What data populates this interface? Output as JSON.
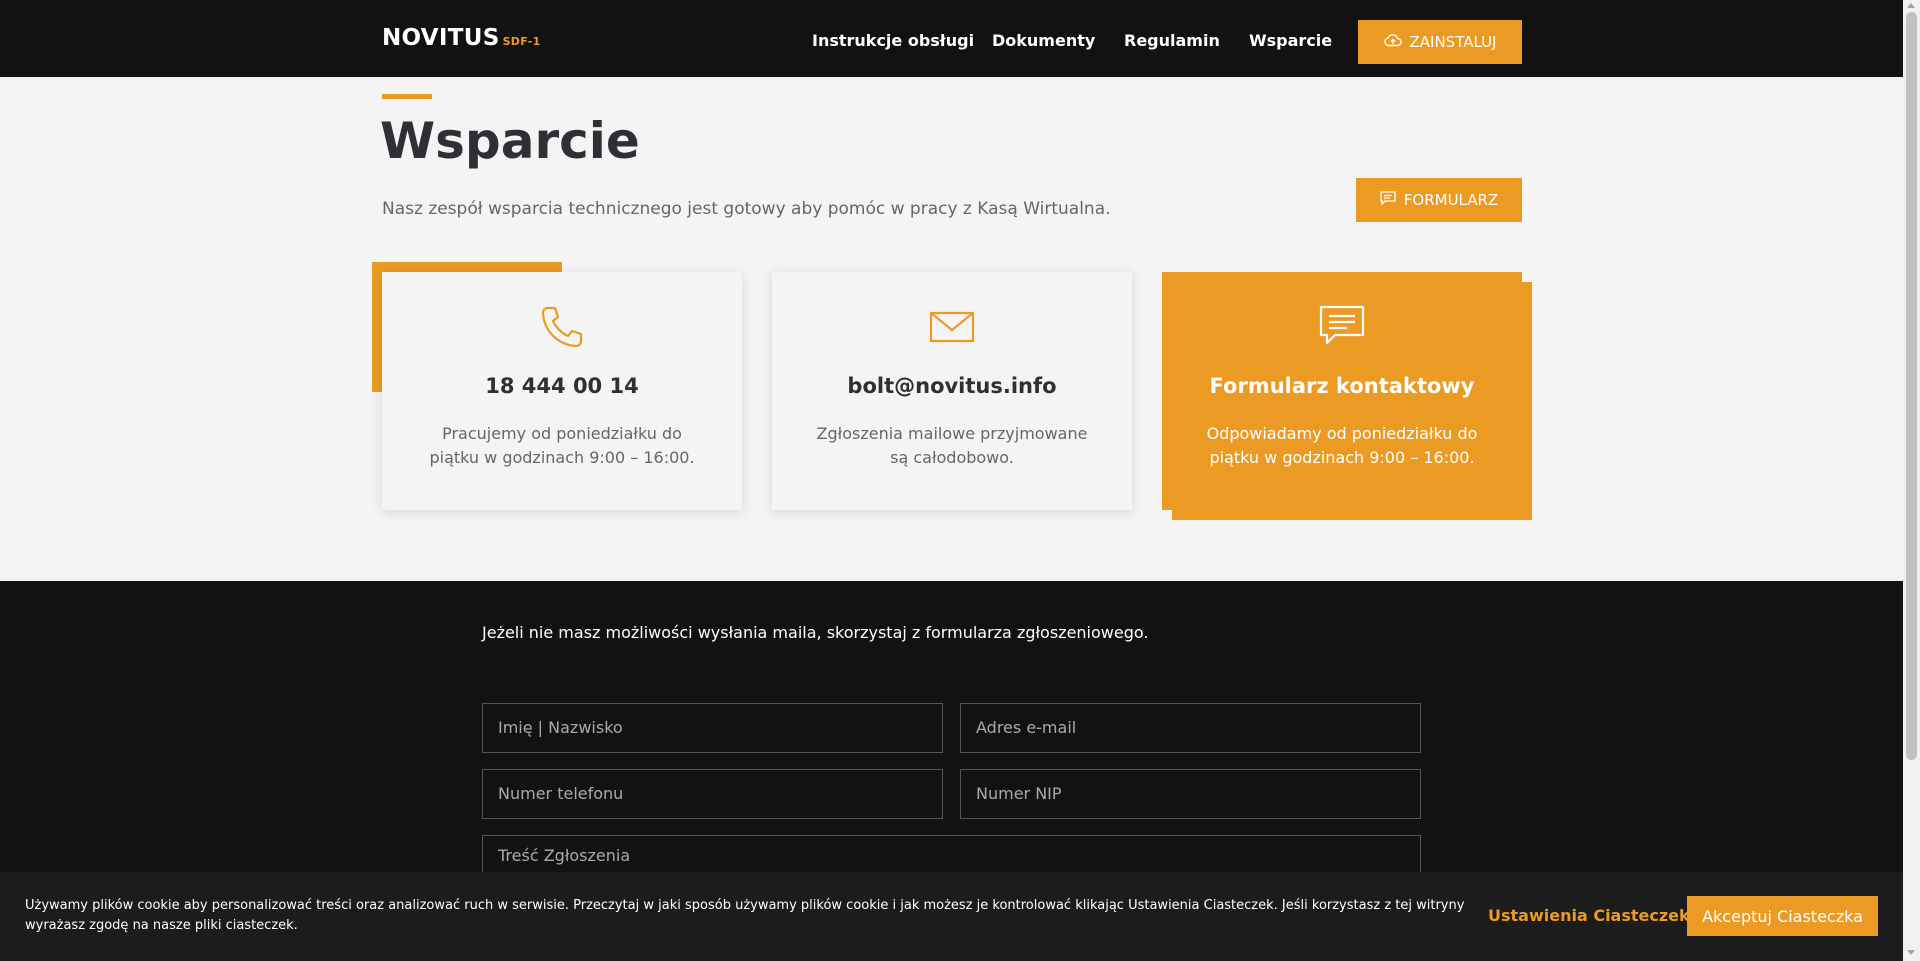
{
  "header": {
    "logo": "NOVITUS",
    "logo_sub": "SDF-1",
    "nav": [
      "Instrukcje obsługi",
      "Dokumenty",
      "Regulamin",
      "Wsparcie"
    ],
    "install_label": "ZAINSTALUJ"
  },
  "hero": {
    "title": "Wsparcie",
    "subtitle": "Nasz zespół wsparcia technicznego jest gotowy aby pomóc w pracy z Kasą Wirtualna.",
    "form_button": "FORMULARZ"
  },
  "cards": [
    {
      "icon": "phone-icon",
      "title": "18 444 00 14",
      "text": "Pracujemy od poniedziałku do piątku  w godzinach 9:00 – 16:00."
    },
    {
      "icon": "mail-icon",
      "title": "bolt@novitus.info",
      "text": "Zgłoszenia mailowe przyjmowane są całodobowo."
    },
    {
      "icon": "chat-icon",
      "title": "Formularz kontaktowy",
      "text": "Odpowiadamy od poniedziałku do piątku  w godzinach 9:00 – 16:00."
    }
  ],
  "form": {
    "intro": "Jeżeli nie masz możliwości wysłania maila, skorzystaj z formularza zgłoszeniowego.",
    "name_placeholder": "Imię | Nazwisko",
    "email_placeholder": "Adres e-mail",
    "phone_placeholder": "Numer telefonu",
    "nip_placeholder": "Numer NIP",
    "message_placeholder": "Treść Zgłoszenia"
  },
  "cookie": {
    "text": "Używamy plików cookie aby personalizować treści oraz analizować ruch w serwisie. Przeczytaj w jaki sposób używamy plików cookie i jak możesz je kontrolować klikając Ustawienia Ciasteczek. Jeśli korzystasz z tej witryny wyrażasz zgodę na nasze pliki ciasteczek.",
    "settings_label": "Ustawienia Ciasteczek",
    "accept_label": "Akceptuj Ciasteczka"
  },
  "colors": {
    "accent": "#eb9a24",
    "dark": "#121212",
    "light": "#f4f4f4"
  }
}
